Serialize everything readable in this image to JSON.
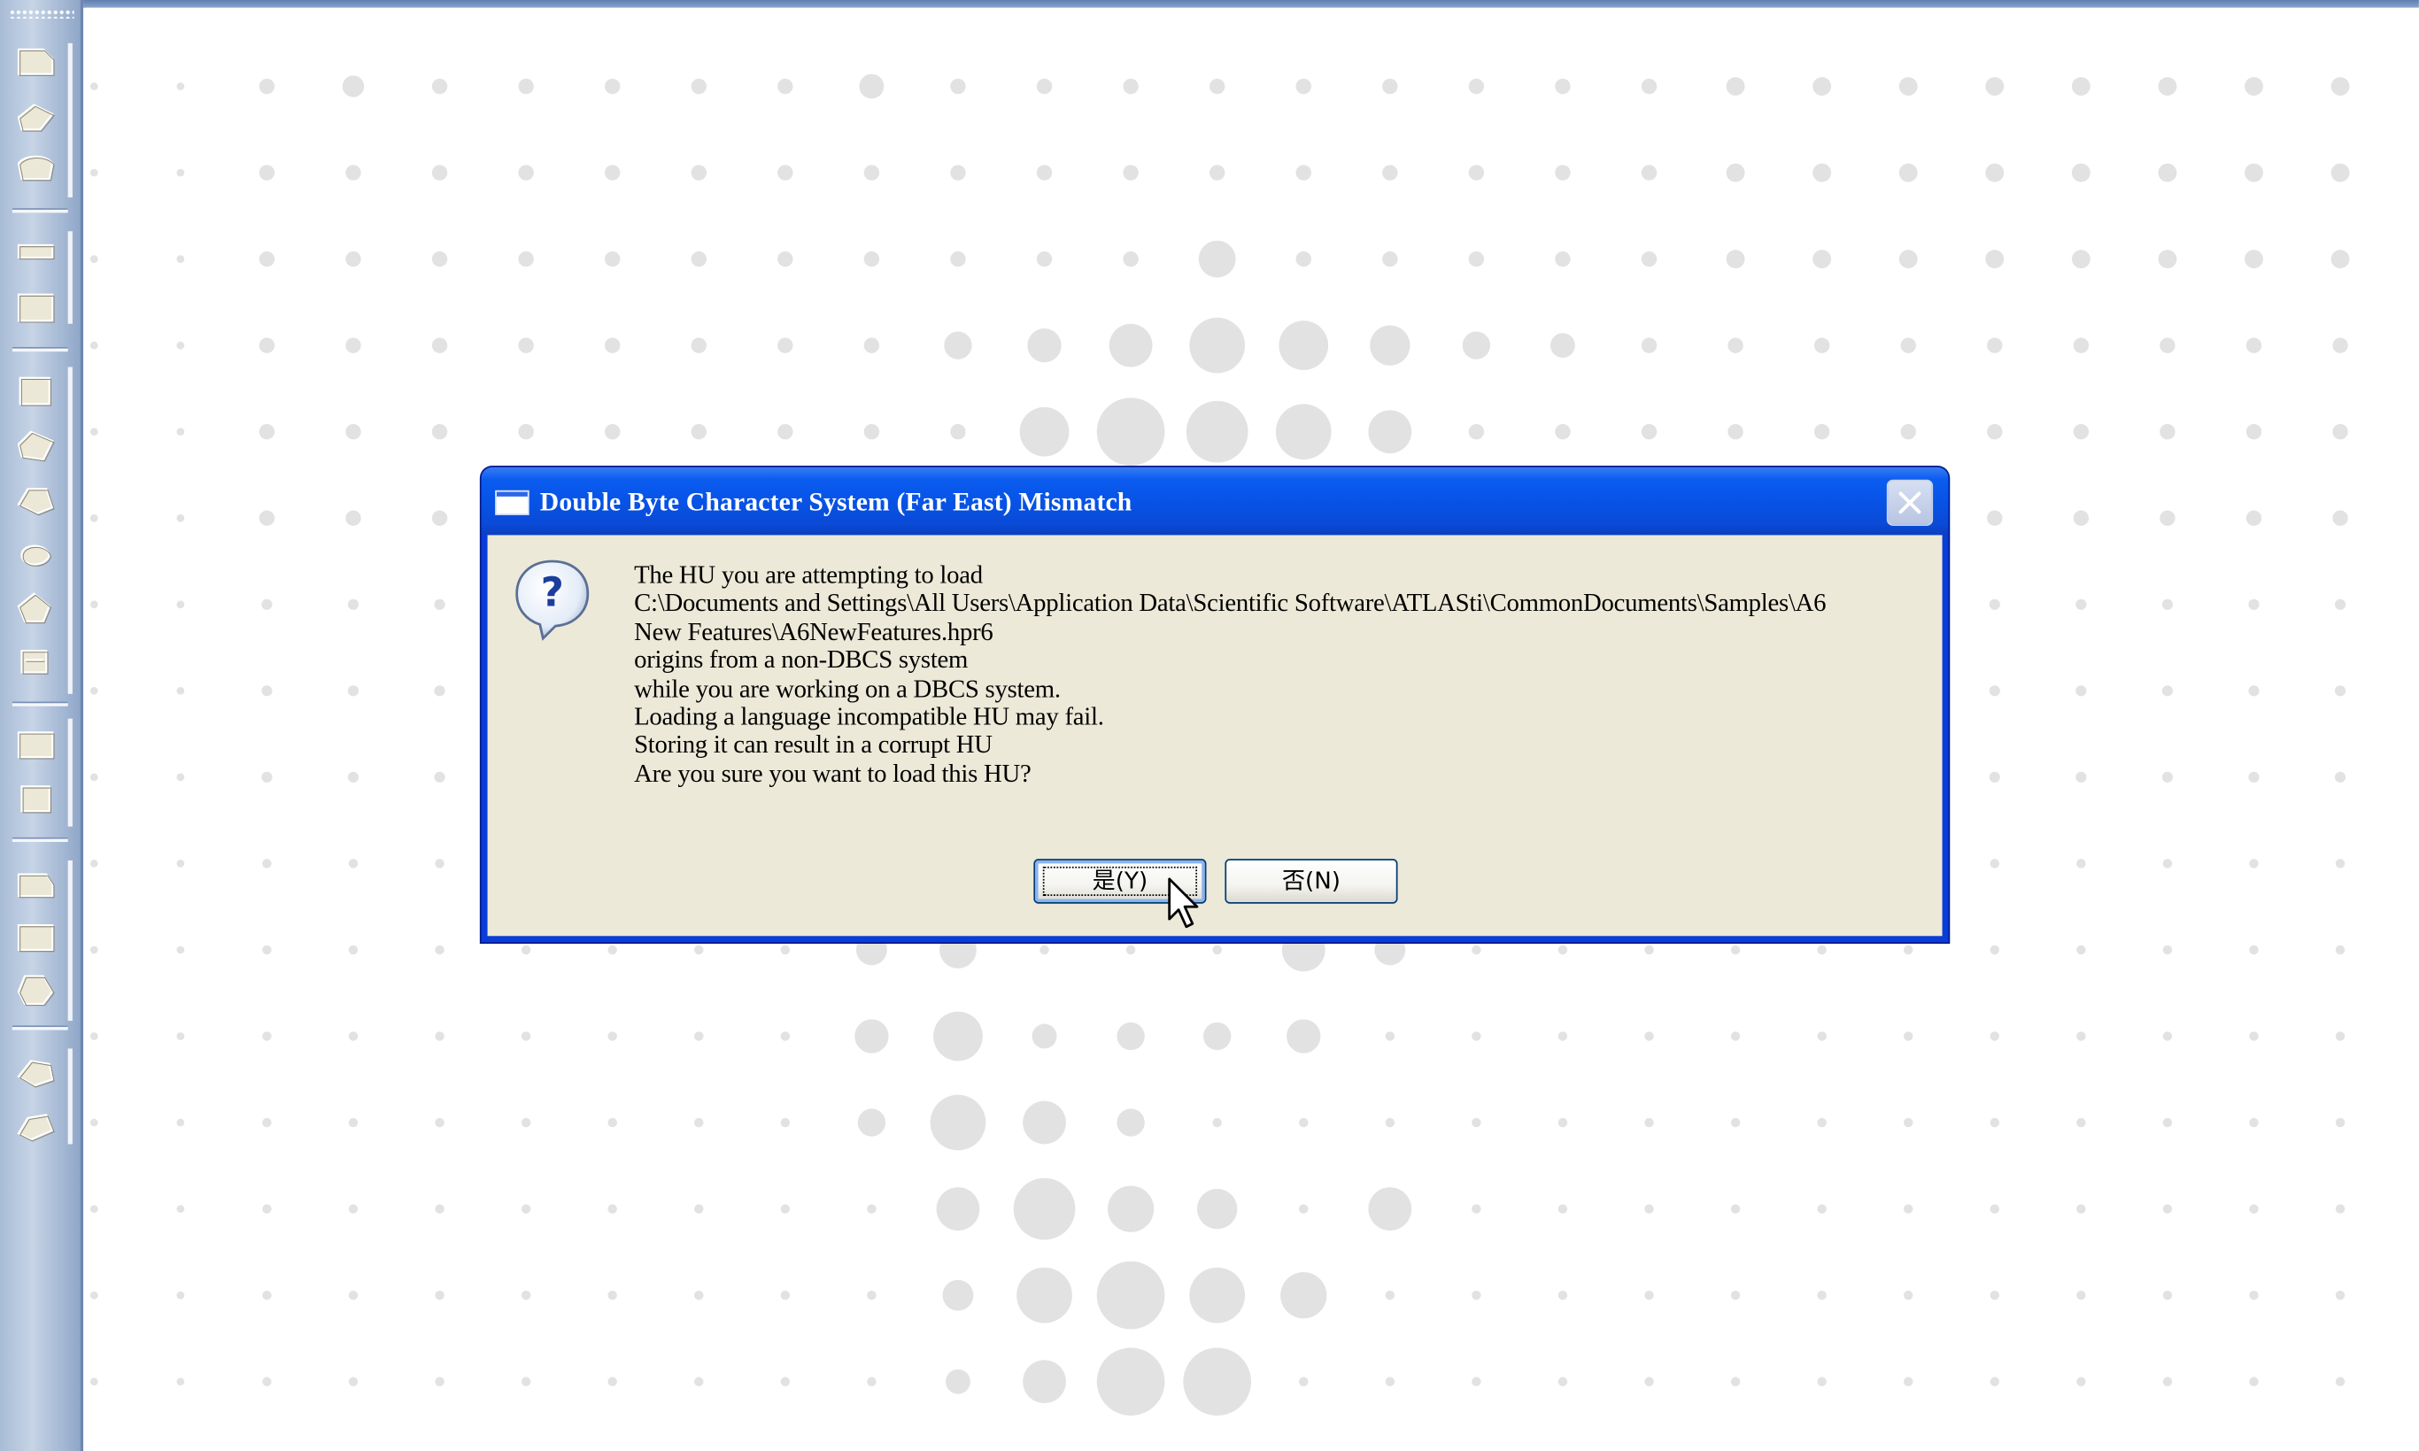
{
  "dialog": {
    "title": "Double Byte Character System (Far East) Mismatch",
    "icon": "question-icon",
    "message_lines": [
      "The HU you are attempting to load",
      "C:\\Documents and Settings\\All Users\\Application Data\\Scientific Software\\ATLASti\\CommonDocuments\\Samples\\A6",
      "New Features\\A6NewFeatures.hpr6",
      "origins from a non-DBCS system",
      "while you are working on a DBCS system.",
      "Loading a language incompatible HU may fail.",
      "Storing it can result in a corrupt HU",
      "Are you sure you want to load this HU?"
    ],
    "buttons": {
      "yes_label": "是(Y)",
      "no_label": "否(N)"
    },
    "close_icon": "close-icon"
  },
  "toolbar": {
    "icons": [
      "tool-icon-1",
      "tool-icon-2",
      "tool-icon-3",
      "tool-icon-4",
      "tool-icon-5",
      "tool-icon-6",
      "tool-icon-7",
      "tool-icon-8",
      "tool-icon-9",
      "tool-icon-10",
      "tool-icon-11",
      "tool-icon-12",
      "tool-icon-13",
      "tool-icon-14",
      "tool-icon-15",
      "tool-icon-16",
      "tool-icon-17",
      "tool-icon-18"
    ]
  },
  "colors": {
    "title_bar": "#0753e6",
    "dialog_face": "#ece9d8",
    "toolbar": "#a9bcd6",
    "dot_pattern": "#e2e2e2"
  }
}
